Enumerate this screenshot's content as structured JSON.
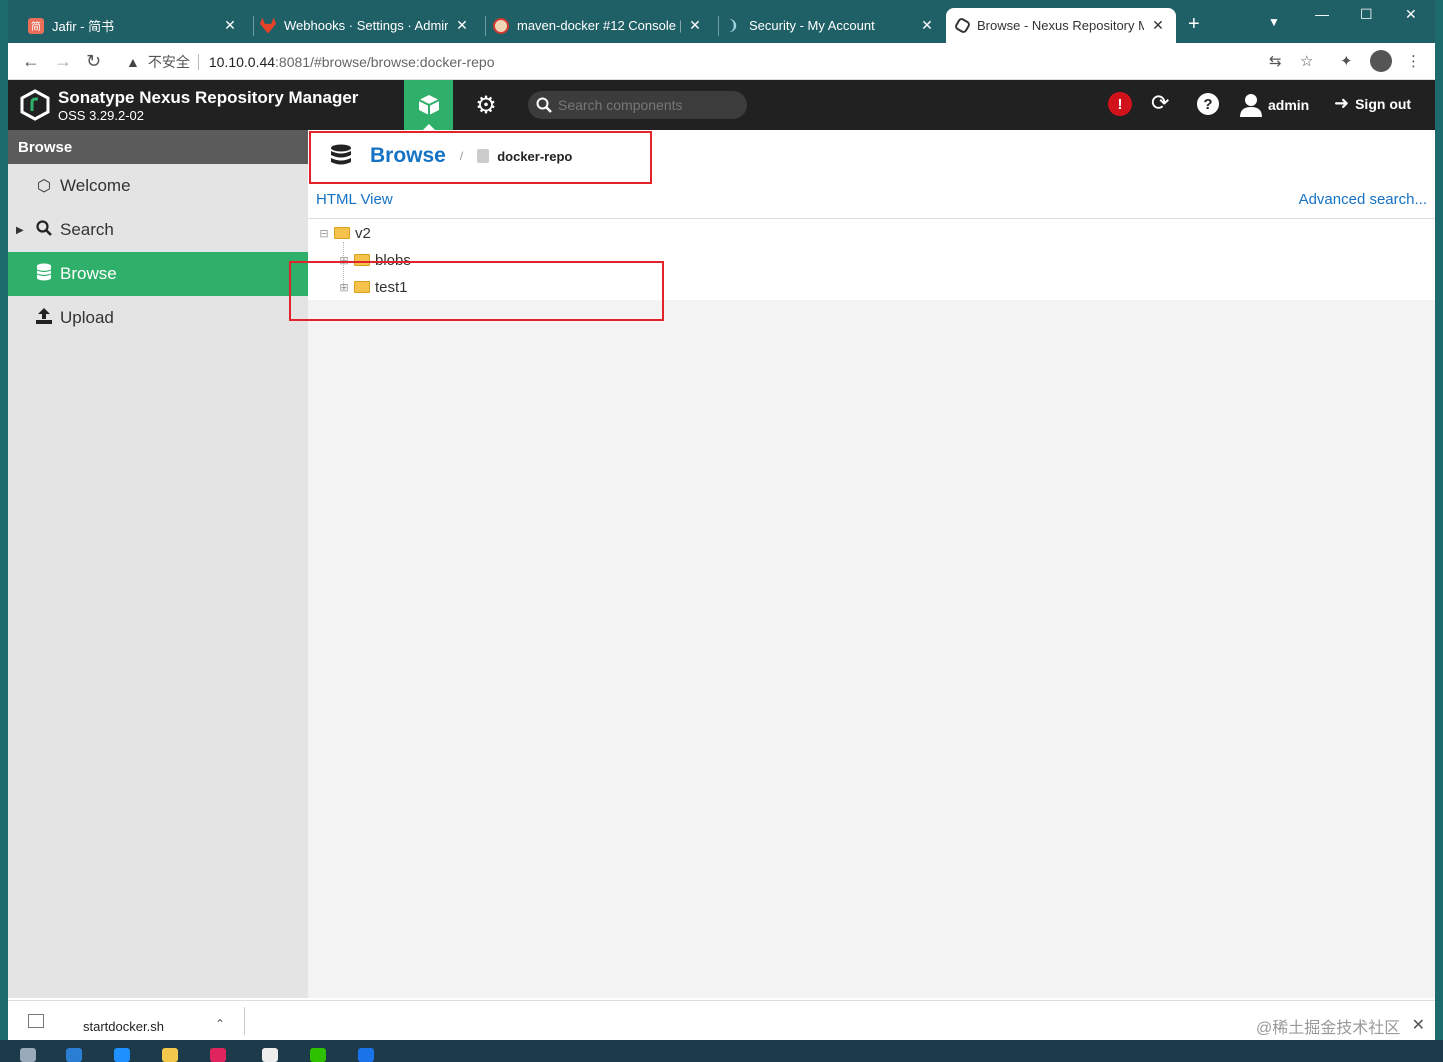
{
  "browser": {
    "tabs": [
      {
        "title": "Jafir - 简书",
        "favicon": "jianshu-icon",
        "color": "#ea6f5a",
        "fav_text": "简"
      },
      {
        "title": "Webhooks · Settings · Admin",
        "favicon": "gitlab-icon",
        "color": "#e24329"
      },
      {
        "title": "maven-docker #12 Console [",
        "favicon": "jenkins-icon",
        "color": "#d33833"
      },
      {
        "title": "Security - My Account",
        "favicon": "feather-icon",
        "color": "#9fd3e0"
      },
      {
        "title": "Browse - Nexus Repository M",
        "favicon": "nexus-icon",
        "color": "#333333"
      }
    ],
    "address": {
      "warning": "不安全",
      "host": "10.10.0.44",
      "path": ":8081/#browse/browse:docker-repo"
    }
  },
  "nexus": {
    "title": "Sonatype Nexus Repository Manager",
    "version": "OSS 3.29.2-02",
    "search_placeholder": "Search components",
    "user": "admin",
    "signout": "Sign out",
    "alert": "!",
    "help": "?"
  },
  "sidebar": {
    "heading": "Browse",
    "items": [
      {
        "label": "Welcome",
        "icon": "hexagon-icon"
      },
      {
        "label": "Search",
        "icon": "search-icon"
      },
      {
        "label": "Browse",
        "icon": "database-icon"
      },
      {
        "label": "Upload",
        "icon": "upload-icon"
      }
    ]
  },
  "main": {
    "breadcrumb": {
      "root": "Browse",
      "separator": "/",
      "repo": "docker-repo"
    },
    "html_view": "HTML View",
    "advanced_search": "Advanced search...",
    "tree": {
      "root": "v2",
      "children": [
        "blobs",
        "test1"
      ]
    }
  },
  "download_bar": {
    "file": "startdocker.sh"
  },
  "watermark": "@稀土掘金技术社区",
  "colors": {
    "nexus_green": "#2fb06a",
    "link_blue": "#1572c5",
    "header_dark": "#212121",
    "annotation_red": "#e0242a"
  }
}
